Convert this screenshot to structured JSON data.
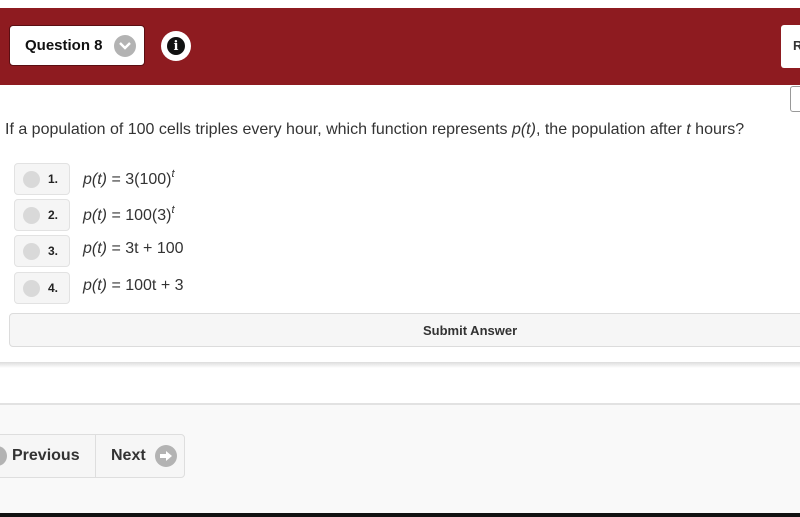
{
  "header": {
    "question_selector_label": "Question 8",
    "chevron_icon": "chevron-down-icon",
    "info_icon": "info-icon",
    "info_glyph": "i",
    "right_button_label": "R",
    "brand_color": "#8e1b20"
  },
  "question": {
    "text_before": "If a population of 100 cells triples every hour, which function represents ",
    "func_name": "p(t)",
    "text_middle": ", the population after ",
    "var": "t",
    "text_after": " hours?"
  },
  "choices": [
    {
      "number": "1.",
      "lhs": "p(t)",
      "rhs": " = 3(100)",
      "sup": "t",
      "selected": false
    },
    {
      "number": "2.",
      "lhs": "p(t)",
      "rhs": " = 100(3)",
      "sup": "t",
      "selected": false
    },
    {
      "number": "3.",
      "lhs": "p(t)",
      "rhs": " = 3t + 100",
      "sup": "",
      "selected": false
    },
    {
      "number": "4.",
      "lhs": "p(t)",
      "rhs": " = 100t + 3",
      "sup": "",
      "selected": false
    }
  ],
  "submit": {
    "label": "Submit Answer"
  },
  "navigation": {
    "previous_label": "Previous",
    "next_label": "Next",
    "previous_icon": "arrow-left-circle-icon",
    "next_icon": "arrow-right-circle-icon"
  }
}
